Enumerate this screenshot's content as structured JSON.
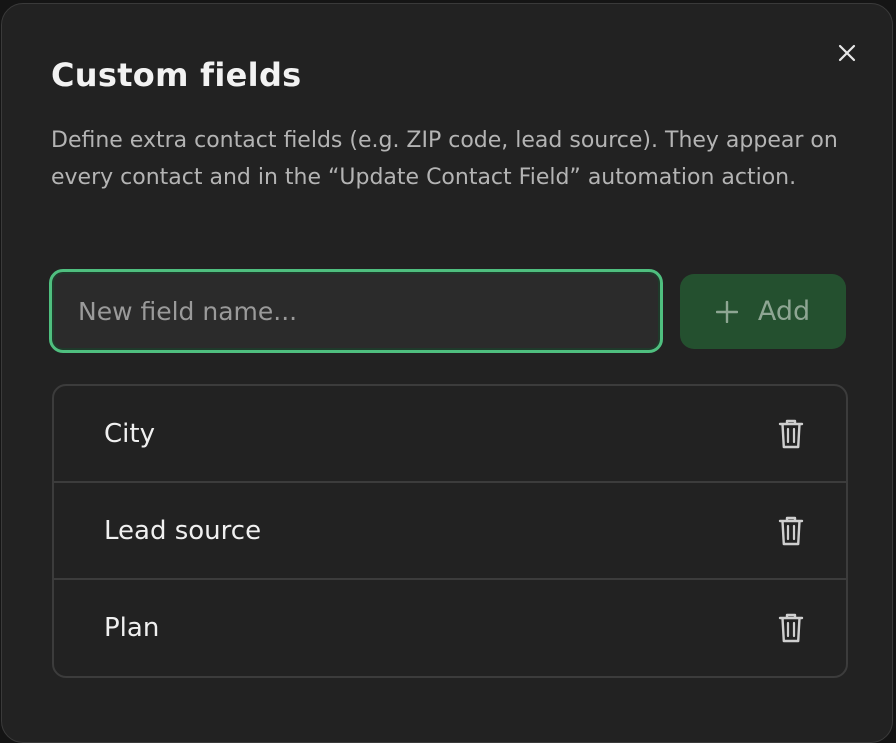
{
  "dialog": {
    "title": "Custom fields",
    "description": "Define extra contact fields (e.g. ZIP code, lead source). They appear on every contact and in the “Update Contact Field” automation action."
  },
  "new_field": {
    "value": "",
    "placeholder": "New field name..."
  },
  "add_button": {
    "label": "Add",
    "icon": "plus-icon"
  },
  "fields": [
    {
      "label": "City",
      "icon": "trash-icon"
    },
    {
      "label": "Lead source",
      "icon": "trash-icon"
    },
    {
      "label": "Plan",
      "icon": "trash-icon"
    }
  ],
  "colors": {
    "accent": "#4fbf7f",
    "add_button_bg": "#24502f",
    "modal_bg": "#222222"
  }
}
